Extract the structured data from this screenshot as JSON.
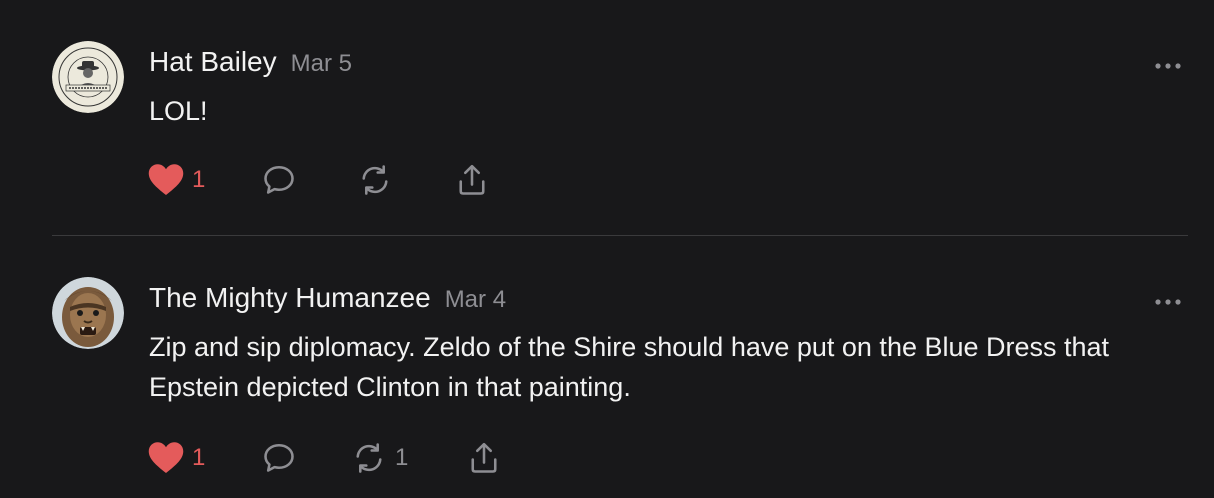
{
  "comments": [
    {
      "author": "Hat Bailey",
      "date": "Mar 5",
      "text": "LOL!",
      "avatar_text_top": "HAT BAILEY WOOD",
      "avatar_text_bottom": "TERLINGUA",
      "likes": "1",
      "restacks": ""
    },
    {
      "author": "The Mighty Humanzee",
      "date": "Mar 4",
      "text": "Zip and sip diplomacy. Zeldo of the Shire should have put on the Blue Dress that Epstein depicted Clinton in that painting.",
      "likes": "1",
      "restacks": "1"
    }
  ],
  "colors": {
    "background": "#18181a",
    "like": "#e45b5b",
    "muted": "#8e8e93",
    "divider": "#3a3a3c"
  },
  "icons": {
    "like": "heart-icon",
    "reply": "speech-bubble-icon",
    "restack": "restack-arrows-icon",
    "share": "share-upload-icon",
    "more": "ellipsis-icon"
  }
}
